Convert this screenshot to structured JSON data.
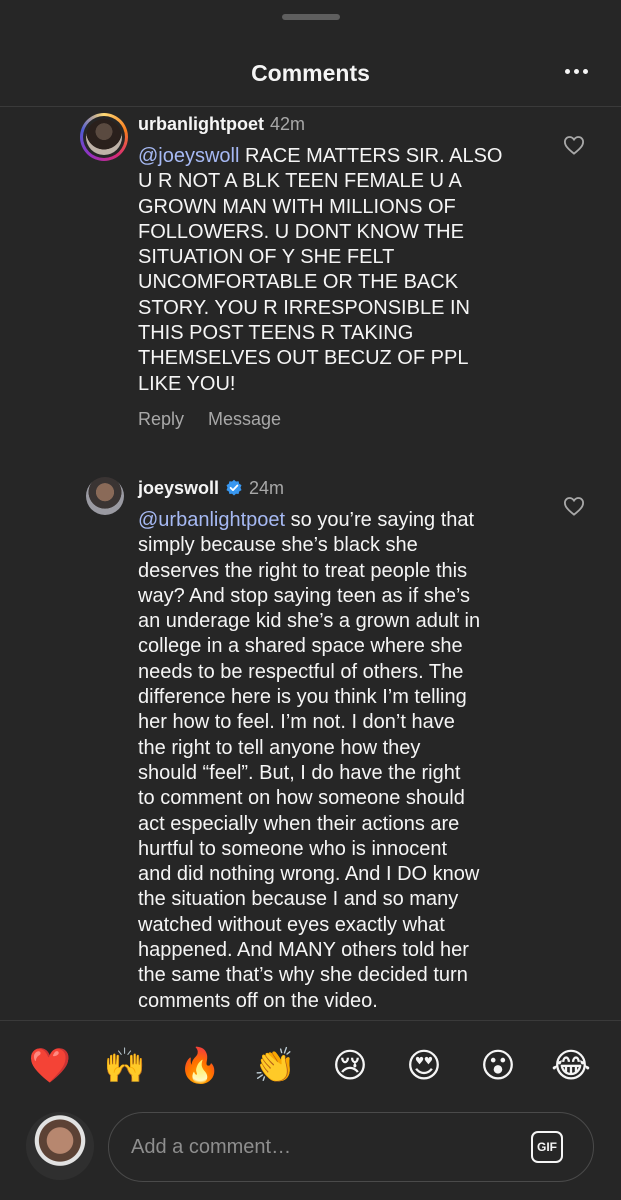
{
  "header": {
    "title": "Comments"
  },
  "comments": [
    {
      "username": "urbanlightpoet",
      "time": "42m",
      "mention": "@joeyswoll",
      "text": " RACE MATTERS SIR. ALSO\nU R NOT A BLK TEEN FEMALE U A\nGROWN MAN WITH MILLIONS OF\nFOLLOWERS. U DONT KNOW THE\nSITUATION OF Y SHE FELT\nUNCOMFORTABLE OR THE BACK\nSTORY. YOU R IRRESPONSIBLE IN\nTHIS POST TEENS R TAKING\nTHEMSELVES OUT BECUZ OF PPL\nLIKE YOU!",
      "reply_label": "Reply",
      "message_label": "Message"
    },
    {
      "username": "joeyswoll",
      "time": "24m",
      "mention": "@urbanlightpoet",
      "text": " so you’re saying that\nsimply because she’s black she\ndeserves the right to treat people this\nway? And stop saying teen as if she’s\nan underage kid she’s a grown adult in\ncollege in a shared space where she\nneeds to be respectful of others. The\ndifference here is you think I’m telling\nher how to feel. I’m not. I don’t have\nthe right to tell anyone how they\nshould “feel”. But, I do have the right\nto comment on how someone should\nact especially when their actions are\nhurtful to someone who is innocent\nand did nothing wrong. And I DO know\nthe situation because I and so many\nwatched without eyes exactly what\nhappened. And MANY others told her\nthe same that’s why she decided turn\ncomments off on the video."
    }
  ],
  "emojis": [
    "❤️",
    "🙌",
    "🔥",
    "👏",
    "😢",
    "😍",
    "😮",
    "😂"
  ],
  "composer": {
    "placeholder": "Add a comment…",
    "gif_label": "GIF"
  },
  "colors": {
    "background": "#262626",
    "mention": "#a6b9f3",
    "verified": "#3897f0",
    "secondary_text": "#a8a8a8"
  }
}
